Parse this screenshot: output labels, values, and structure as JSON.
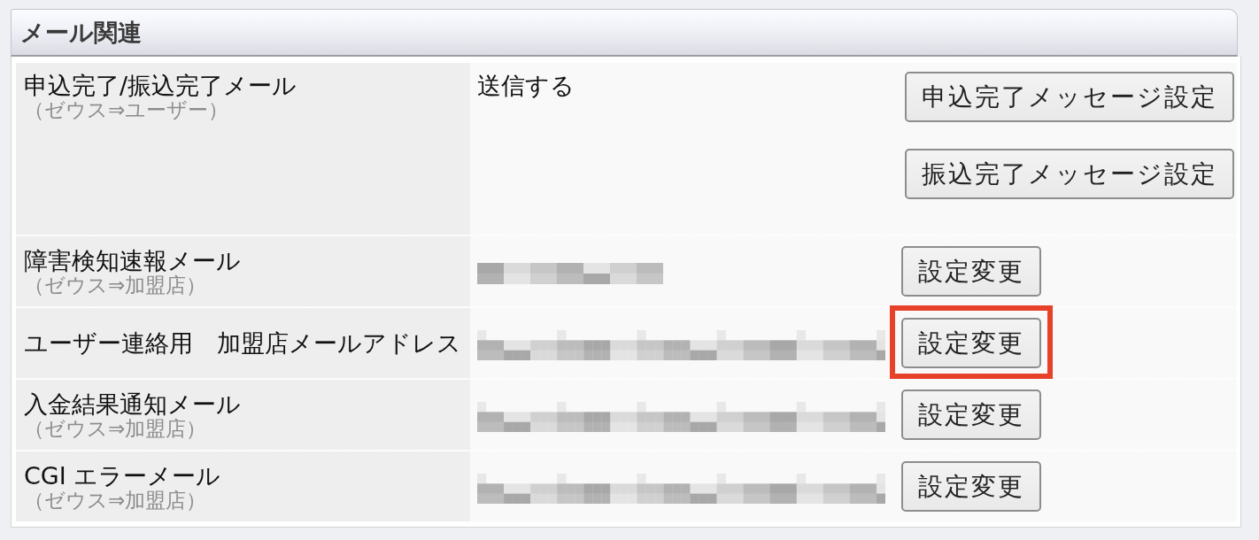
{
  "section": {
    "title": "メール関連"
  },
  "rows": [
    {
      "label": "申込完了/振込完了メール",
      "direction": "（ゼウス⇒ユーザー）",
      "value": {
        "kind": "text",
        "text": "送信する"
      },
      "buttons": [
        {
          "label": "申込完了メッセージ設定",
          "highlighted": false
        },
        {
          "label": "振込完了メッセージ設定",
          "highlighted": false
        }
      ]
    },
    {
      "label": "障害検知速報メール",
      "direction": "（ゼウス⇒加盟店）",
      "value": {
        "kind": "masked",
        "short": true
      },
      "buttons": [
        {
          "label": "設定変更",
          "highlighted": false
        }
      ]
    },
    {
      "label": "ユーザー連絡用　加盟店メールアドレス",
      "value": {
        "kind": "masked",
        "short": false
      },
      "buttons": [
        {
          "label": "設定変更",
          "highlighted": true
        }
      ]
    },
    {
      "label": "入金結果通知メール",
      "direction": "（ゼウス⇒加盟店）",
      "value": {
        "kind": "masked",
        "short": false
      },
      "buttons": [
        {
          "label": "設定変更",
          "highlighted": false
        }
      ]
    },
    {
      "label": "CGI エラーメール",
      "direction": "（ゼウス⇒加盟店）",
      "value": {
        "kind": "masked",
        "short": false
      },
      "buttons": [
        {
          "label": "設定変更",
          "highlighted": false
        }
      ]
    }
  ]
}
